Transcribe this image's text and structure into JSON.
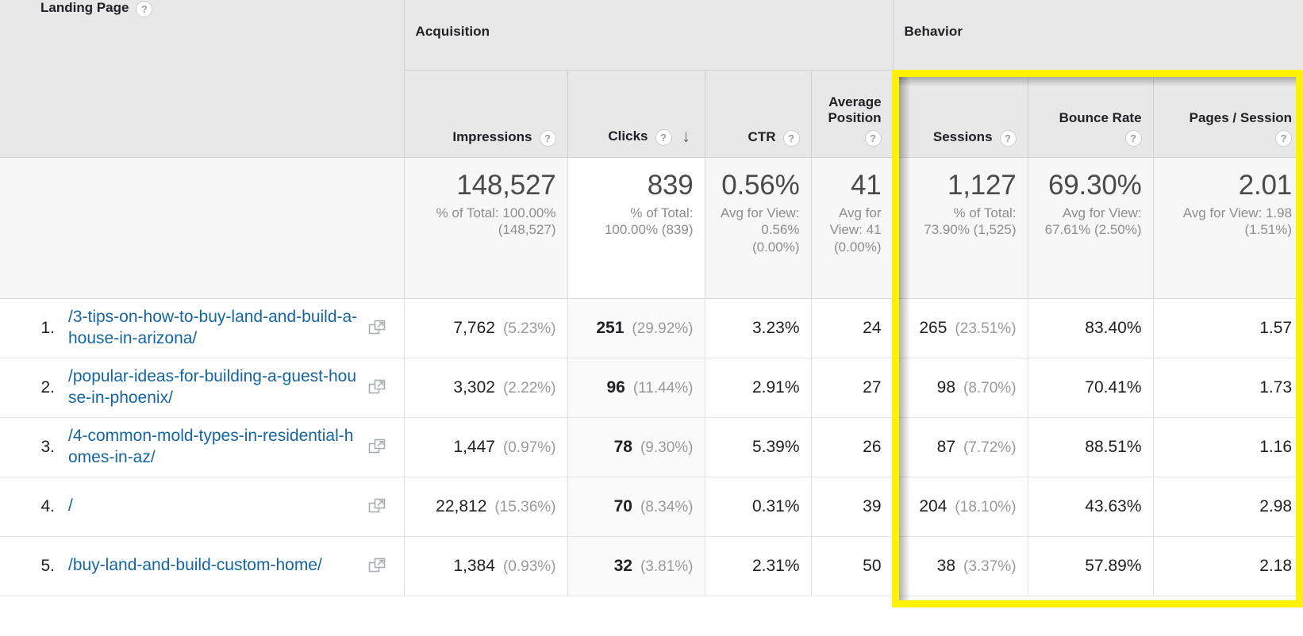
{
  "table": {
    "dimension_header": {
      "label": "Landing Page",
      "help": "?"
    },
    "groups": [
      {
        "name": "acquisition",
        "label": "Acquisition"
      },
      {
        "name": "behavior",
        "label": "Behavior"
      }
    ],
    "columns": [
      {
        "key": "impressions",
        "label": "Impressions",
        "help": "?",
        "sorted": false
      },
      {
        "key": "clicks",
        "label": "Clicks",
        "help": "?",
        "sorted": true,
        "sort_dir": "↓"
      },
      {
        "key": "ctr",
        "label": "CTR",
        "help": "?",
        "sorted": false
      },
      {
        "key": "average_position",
        "label": "Average Position",
        "help": "?",
        "sorted": false
      },
      {
        "key": "sessions",
        "label": "Sessions",
        "help": "?",
        "sorted": false
      },
      {
        "key": "bounce_rate",
        "label": "Bounce Rate",
        "help": "?",
        "sorted": false
      },
      {
        "key": "pages_session",
        "label": "Pages / Session",
        "help": "?",
        "sorted": false
      }
    ],
    "summary": {
      "impressions": {
        "value": "148,527",
        "note": "% of Total: 100.00% (148,527)"
      },
      "clicks": {
        "value": "839",
        "note": "% of Total: 100.00% (839)"
      },
      "ctr": {
        "value": "0.56%",
        "note": "Avg for View: 0.56% (0.00%)"
      },
      "average_position": {
        "value": "41",
        "note": "Avg for View: 41 (0.00%)"
      },
      "sessions": {
        "value": "1,127",
        "note": "% of Total: 73.90% (1,525)"
      },
      "bounce_rate": {
        "value": "69.30%",
        "note": "Avg for View: 67.61% (2.50%)"
      },
      "pages_session": {
        "value": "2.01",
        "note": "Avg for View: 1.98 (1.51%)"
      }
    },
    "rows": [
      {
        "rank": "1.",
        "landing_page": "/3-tips-on-how-to-buy-land-and-build-a-house-in-arizona/",
        "open_icon": "open-in-new-icon",
        "impressions": "7,762",
        "impressions_pct": "(5.23%)",
        "clicks": "251",
        "clicks_pct": "(29.92%)",
        "ctr": "3.23%",
        "average_position": "24",
        "sessions": "265",
        "sessions_pct": "(23.51%)",
        "bounce_rate": "83.40%",
        "pages_session": "1.57"
      },
      {
        "rank": "2.",
        "landing_page": "/popular-ideas-for-building-a-guest-house-in-phoenix/",
        "open_icon": "open-in-new-icon",
        "impressions": "3,302",
        "impressions_pct": "(2.22%)",
        "clicks": "96",
        "clicks_pct": "(11.44%)",
        "ctr": "2.91%",
        "average_position": "27",
        "sessions": "98",
        "sessions_pct": "(8.70%)",
        "bounce_rate": "70.41%",
        "pages_session": "1.73"
      },
      {
        "rank": "3.",
        "landing_page": "/4-common-mold-types-in-residential-homes-in-az/",
        "open_icon": "open-in-new-icon",
        "impressions": "1,447",
        "impressions_pct": "(0.97%)",
        "clicks": "78",
        "clicks_pct": "(9.30%)",
        "ctr": "5.39%",
        "average_position": "26",
        "sessions": "87",
        "sessions_pct": "(7.72%)",
        "bounce_rate": "88.51%",
        "pages_session": "1.16"
      },
      {
        "rank": "4.",
        "landing_page": "/",
        "open_icon": "open-in-new-icon",
        "impressions": "22,812",
        "impressions_pct": "(15.36%)",
        "clicks": "70",
        "clicks_pct": "(8.34%)",
        "ctr": "0.31%",
        "average_position": "39",
        "sessions": "204",
        "sessions_pct": "(18.10%)",
        "bounce_rate": "43.63%",
        "pages_session": "2.98"
      },
      {
        "rank": "5.",
        "landing_page": "/buy-land-and-build-custom-home/",
        "open_icon": "open-in-new-icon",
        "impressions": "1,384",
        "impressions_pct": "(0.93%)",
        "clicks": "32",
        "clicks_pct": "(3.81%)",
        "ctr": "2.31%",
        "average_position": "50",
        "sessions": "38",
        "sessions_pct": "(3.37%)",
        "bounce_rate": "57.89%",
        "pages_session": "2.18"
      }
    ]
  },
  "annotation": {
    "name": "highlight-box",
    "color": "#fff200",
    "covers": [
      "Sessions",
      "Bounce Rate",
      "Pages / Session"
    ]
  }
}
